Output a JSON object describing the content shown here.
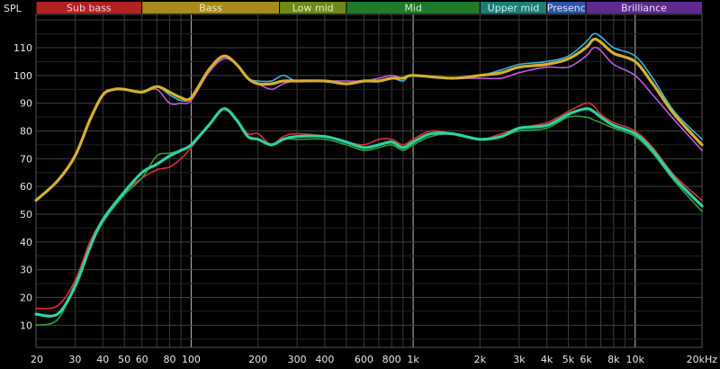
{
  "chart_data": {
    "type": "line",
    "ylabel": "SPL",
    "x_scale": "log",
    "xlim": [
      20,
      20000
    ],
    "ylim": [
      2,
      122
    ],
    "grid": true,
    "x_tick_labels": [
      "20",
      "30",
      "40",
      "50",
      "60",
      "80",
      "100",
      "200",
      "300",
      "400",
      "600",
      "800",
      "1k",
      "2k",
      "3k",
      "4k",
      "5k",
      "6k",
      "8k",
      "10k",
      "20kHz"
    ],
    "y_ticks": [
      10,
      20,
      30,
      40,
      50,
      60,
      70,
      80,
      90,
      100,
      110
    ],
    "bands": [
      {
        "label": "Sub bass",
        "from": 20,
        "to": 60,
        "color": "#b32222",
        "text": "#f0d0d0"
      },
      {
        "label": "Bass",
        "from": 60,
        "to": 250,
        "color": "#a88a1e",
        "text": "#f4ecc0"
      },
      {
        "label": "Low mid",
        "from": 250,
        "to": 500,
        "color": "#6e8a18",
        "text": "#e4f0c0"
      },
      {
        "label": "Mid",
        "from": 500,
        "to": 2000,
        "color": "#1f7a2a",
        "text": "#d4f0d0"
      },
      {
        "label": "Upper mid",
        "from": 2000,
        "to": 4000,
        "color": "#1e7d78",
        "text": "#cdf2ee"
      },
      {
        "label": "Presenc",
        "from": 4000,
        "to": 6000,
        "color": "#2a56a8",
        "text": "#dde8ff"
      },
      {
        "label": "Brilliance",
        "from": 6000,
        "to": 20000,
        "color": "#5e2a8e",
        "text": "#eadcff"
      }
    ],
    "series": [
      {
        "color": "#38b6d8",
        "width": 1.6,
        "points": [
          [
            20,
            55
          ],
          [
            25,
            62
          ],
          [
            30,
            71
          ],
          [
            35,
            84
          ],
          [
            40,
            93
          ],
          [
            45,
            95
          ],
          [
            50,
            95
          ],
          [
            60,
            94
          ],
          [
            70,
            96
          ],
          [
            80,
            93
          ],
          [
            90,
            91
          ],
          [
            100,
            92
          ],
          [
            120,
            102
          ],
          [
            140,
            107
          ],
          [
            160,
            104
          ],
          [
            180,
            99
          ],
          [
            200,
            98
          ],
          [
            230,
            98
          ],
          [
            260,
            100
          ],
          [
            300,
            98
          ],
          [
            400,
            98
          ],
          [
            500,
            97
          ],
          [
            600,
            98
          ],
          [
            700,
            98
          ],
          [
            800,
            99
          ],
          [
            900,
            98
          ],
          [
            1000,
            100
          ],
          [
            1500,
            99
          ],
          [
            2000,
            100
          ],
          [
            2500,
            102
          ],
          [
            3000,
            104
          ],
          [
            4000,
            105
          ],
          [
            5000,
            107
          ],
          [
            6000,
            112
          ],
          [
            6500,
            115
          ],
          [
            7000,
            114
          ],
          [
            8000,
            110
          ],
          [
            10000,
            107
          ],
          [
            12000,
            99
          ],
          [
            15000,
            87
          ],
          [
            20000,
            77
          ]
        ]
      },
      {
        "color": "#c05ae0",
        "width": 1.6,
        "points": [
          [
            20,
            55
          ],
          [
            25,
            62
          ],
          [
            30,
            71
          ],
          [
            35,
            84
          ],
          [
            40,
            93
          ],
          [
            45,
            95
          ],
          [
            50,
            95
          ],
          [
            60,
            94
          ],
          [
            70,
            95
          ],
          [
            80,
            90
          ],
          [
            90,
            90
          ],
          [
            100,
            91
          ],
          [
            120,
            101
          ],
          [
            140,
            106
          ],
          [
            160,
            104
          ],
          [
            180,
            99
          ],
          [
            200,
            97
          ],
          [
            230,
            95
          ],
          [
            260,
            97
          ],
          [
            300,
            98
          ],
          [
            400,
            98
          ],
          [
            500,
            98
          ],
          [
            600,
            98
          ],
          [
            700,
            99
          ],
          [
            800,
            100
          ],
          [
            900,
            99
          ],
          [
            1000,
            100
          ],
          [
            1500,
            99
          ],
          [
            2000,
            99
          ],
          [
            2500,
            99
          ],
          [
            3000,
            101
          ],
          [
            4000,
            103
          ],
          [
            5000,
            103
          ],
          [
            6000,
            107
          ],
          [
            6500,
            110
          ],
          [
            7000,
            109
          ],
          [
            8000,
            104
          ],
          [
            10000,
            100
          ],
          [
            12000,
            93
          ],
          [
            15000,
            84
          ],
          [
            20000,
            73
          ]
        ]
      },
      {
        "color": "#d4b030",
        "width": 3.2,
        "points": [
          [
            20,
            55
          ],
          [
            25,
            62
          ],
          [
            30,
            71
          ],
          [
            35,
            84
          ],
          [
            40,
            93
          ],
          [
            45,
            95
          ],
          [
            50,
            95
          ],
          [
            60,
            94
          ],
          [
            70,
            96
          ],
          [
            80,
            94
          ],
          [
            90,
            92
          ],
          [
            100,
            92
          ],
          [
            120,
            102
          ],
          [
            140,
            107
          ],
          [
            160,
            104
          ],
          [
            180,
            99
          ],
          [
            200,
            97
          ],
          [
            230,
            97
          ],
          [
            260,
            98
          ],
          [
            300,
            98
          ],
          [
            400,
            98
          ],
          [
            500,
            97
          ],
          [
            600,
            98
          ],
          [
            700,
            98
          ],
          [
            800,
            99
          ],
          [
            900,
            99
          ],
          [
            1000,
            100
          ],
          [
            1500,
            99
          ],
          [
            2000,
            100
          ],
          [
            2500,
            101
          ],
          [
            3000,
            103
          ],
          [
            4000,
            104
          ],
          [
            5000,
            106
          ],
          [
            6000,
            110
          ],
          [
            6500,
            113
          ],
          [
            7000,
            112
          ],
          [
            8000,
            108
          ],
          [
            10000,
            105
          ],
          [
            12000,
            97
          ],
          [
            15000,
            86
          ],
          [
            20000,
            75
          ]
        ]
      },
      {
        "color": "#e03030",
        "width": 1.6,
        "points": [
          [
            20,
            16
          ],
          [
            25,
            17
          ],
          [
            30,
            26
          ],
          [
            35,
            40
          ],
          [
            40,
            48
          ],
          [
            50,
            58
          ],
          [
            60,
            63
          ],
          [
            70,
            66
          ],
          [
            80,
            67
          ],
          [
            90,
            70
          ],
          [
            100,
            74
          ],
          [
            120,
            82
          ],
          [
            140,
            88
          ],
          [
            160,
            84
          ],
          [
            180,
            79
          ],
          [
            200,
            79
          ],
          [
            230,
            75
          ],
          [
            260,
            78
          ],
          [
            300,
            79
          ],
          [
            400,
            78
          ],
          [
            500,
            76
          ],
          [
            600,
            75
          ],
          [
            700,
            77
          ],
          [
            800,
            77
          ],
          [
            900,
            75
          ],
          [
            1000,
            77
          ],
          [
            1200,
            80
          ],
          [
            1500,
            79
          ],
          [
            2000,
            77
          ],
          [
            2500,
            79
          ],
          [
            3000,
            81
          ],
          [
            4000,
            83
          ],
          [
            5000,
            87
          ],
          [
            6000,
            90
          ],
          [
            6500,
            89
          ],
          [
            7000,
            86
          ],
          [
            8000,
            83
          ],
          [
            10000,
            80
          ],
          [
            12000,
            74
          ],
          [
            15000,
            64
          ],
          [
            20000,
            55
          ]
        ]
      },
      {
        "color": "#2ea040",
        "width": 1.6,
        "points": [
          [
            20,
            10
          ],
          [
            25,
            12
          ],
          [
            30,
            25
          ],
          [
            35,
            38
          ],
          [
            40,
            47
          ],
          [
            50,
            57
          ],
          [
            60,
            63
          ],
          [
            70,
            71
          ],
          [
            80,
            72
          ],
          [
            90,
            73
          ],
          [
            100,
            75
          ],
          [
            120,
            82
          ],
          [
            140,
            88
          ],
          [
            160,
            84
          ],
          [
            180,
            78
          ],
          [
            200,
            77
          ],
          [
            230,
            75
          ],
          [
            260,
            77
          ],
          [
            300,
            77
          ],
          [
            400,
            77
          ],
          [
            500,
            75
          ],
          [
            600,
            73
          ],
          [
            700,
            74
          ],
          [
            800,
            75
          ],
          [
            900,
            73
          ],
          [
            1000,
            75
          ],
          [
            1200,
            78
          ],
          [
            1500,
            79
          ],
          [
            2000,
            77
          ],
          [
            2500,
            78
          ],
          [
            3000,
            80
          ],
          [
            4000,
            81
          ],
          [
            5000,
            85
          ],
          [
            6000,
            85
          ],
          [
            6500,
            84
          ],
          [
            7000,
            83
          ],
          [
            8000,
            81
          ],
          [
            10000,
            78
          ],
          [
            12000,
            72
          ],
          [
            15000,
            62
          ],
          [
            20000,
            51
          ]
        ]
      },
      {
        "color": "#30d0a0",
        "width": 3.2,
        "points": [
          [
            20,
            14
          ],
          [
            25,
            14
          ],
          [
            30,
            24
          ],
          [
            35,
            38
          ],
          [
            40,
            48
          ],
          [
            50,
            58
          ],
          [
            60,
            65
          ],
          [
            70,
            68
          ],
          [
            80,
            71
          ],
          [
            90,
            73
          ],
          [
            100,
            75
          ],
          [
            120,
            82
          ],
          [
            140,
            88
          ],
          [
            160,
            84
          ],
          [
            180,
            78
          ],
          [
            200,
            77
          ],
          [
            230,
            75
          ],
          [
            260,
            77
          ],
          [
            300,
            78
          ],
          [
            400,
            78
          ],
          [
            500,
            76
          ],
          [
            600,
            74
          ],
          [
            700,
            75
          ],
          [
            800,
            76
          ],
          [
            900,
            74
          ],
          [
            1000,
            76
          ],
          [
            1200,
            79
          ],
          [
            1500,
            79
          ],
          [
            2000,
            77
          ],
          [
            2500,
            78
          ],
          [
            3000,
            81
          ],
          [
            4000,
            82
          ],
          [
            5000,
            86
          ],
          [
            6000,
            88
          ],
          [
            6500,
            87
          ],
          [
            7000,
            85
          ],
          [
            8000,
            82
          ],
          [
            10000,
            79
          ],
          [
            12000,
            73
          ],
          [
            15000,
            63
          ],
          [
            20000,
            53
          ]
        ]
      }
    ]
  }
}
